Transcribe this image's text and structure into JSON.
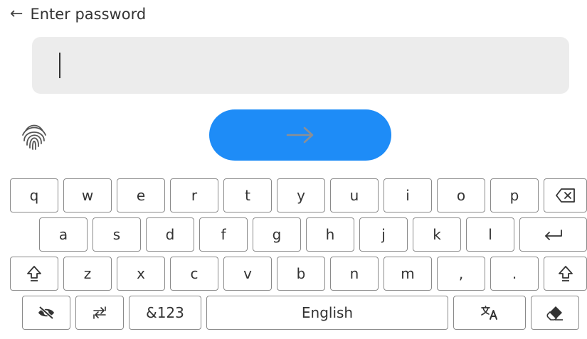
{
  "header": {
    "back_icon": "back-arrow-icon",
    "title": "Enter password"
  },
  "password_field": {
    "value": ""
  },
  "submit": {
    "icon": "arrow-right-icon"
  },
  "fingerprint": {
    "icon": "fingerprint-icon"
  },
  "keyboard": {
    "row1": [
      "q",
      "w",
      "e",
      "r",
      "t",
      "y",
      "u",
      "i",
      "o",
      "p"
    ],
    "row2": [
      "a",
      "s",
      "d",
      "f",
      "g",
      "h",
      "j",
      "k",
      "l"
    ],
    "row3": [
      "z",
      "x",
      "c",
      "v",
      "b",
      "n",
      "m",
      ",",
      "."
    ],
    "symbols_label": "&123",
    "space_label": "English",
    "icons": {
      "backspace": "backspace-icon",
      "enter": "enter-icon",
      "shift": "shift-icon",
      "hide_password": "eye-off-icon",
      "switch": "switch-arrows-icon",
      "translate": "translate-icon",
      "clear": "eraser-icon"
    }
  },
  "colors": {
    "accent": "#1e8cf7",
    "field_bg": "#ececec",
    "key_border": "#8a8a8a"
  }
}
